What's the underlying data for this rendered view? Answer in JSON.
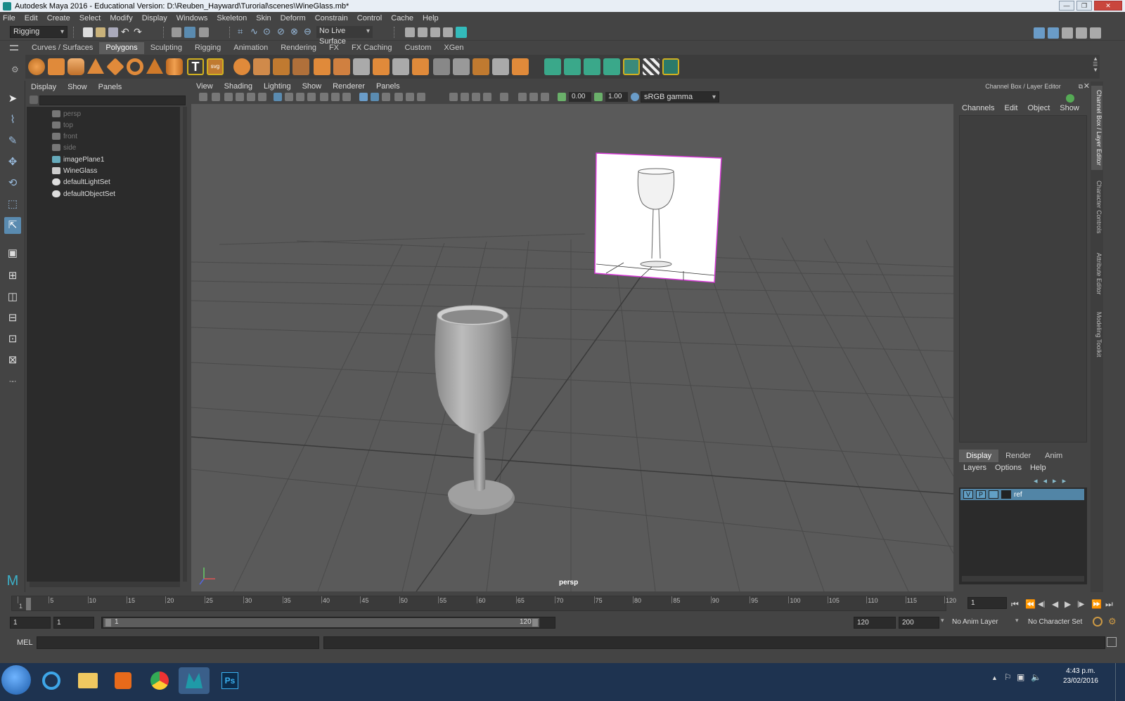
{
  "window": {
    "title": "Autodesk Maya 2016 - Educational Version: D:\\Reuben_Hayward\\Turorial\\scenes\\WineGlass.mb*",
    "min_label": "—",
    "max_label": "❐",
    "close_label": "✕"
  },
  "menubar": [
    "File",
    "Edit",
    "Create",
    "Select",
    "Modify",
    "Display",
    "Windows",
    "Skeleton",
    "Skin",
    "Deform",
    "Constrain",
    "Control",
    "Cache",
    "Help"
  ],
  "statusline": {
    "menuset": "Rigging",
    "live_surface": "No Live Surface"
  },
  "shelf": {
    "tabs": [
      "Curves / Surfaces",
      "Polygons",
      "Sculpting",
      "Rigging",
      "Animation",
      "Rendering",
      "FX",
      "FX Caching",
      "Custom",
      "XGen"
    ],
    "active_tab": "Polygons",
    "text_tool_label": "T",
    "svg_tool_label": "svg"
  },
  "outliner": {
    "menu": [
      "Display",
      "Show",
      "Panels"
    ],
    "items": [
      {
        "label": "persp",
        "dim": true,
        "icon": "camera-icon"
      },
      {
        "label": "top",
        "dim": true,
        "icon": "camera-icon"
      },
      {
        "label": "front",
        "dim": true,
        "icon": "camera-icon"
      },
      {
        "label": "side",
        "dim": true,
        "icon": "camera-icon"
      },
      {
        "label": "imagePlane1",
        "dim": false,
        "icon": "image-plane-icon"
      },
      {
        "label": "WineGlass",
        "dim": false,
        "icon": "mesh-icon"
      },
      {
        "label": "defaultLightSet",
        "dim": false,
        "icon": "set-icon"
      },
      {
        "label": "defaultObjectSet",
        "dim": false,
        "icon": "set-icon"
      }
    ]
  },
  "viewport": {
    "menu": [
      "View",
      "Shading",
      "Lighting",
      "Show",
      "Renderer",
      "Panels"
    ],
    "exposure": "0.00",
    "gamma": "1.00",
    "color_space": "sRGB gamma",
    "camera_label": "persp"
  },
  "channelbox": {
    "title": "Channel Box / Layer Editor",
    "menu": [
      "Channels",
      "Edit",
      "Object",
      "Show"
    ],
    "layer_tabs": [
      "Display",
      "Render",
      "Anim"
    ],
    "active_layer_tab": "Display",
    "layer_menu": [
      "Layers",
      "Options",
      "Help"
    ],
    "layers": [
      {
        "name": "ref",
        "v": "V",
        "p": "P"
      }
    ]
  },
  "sidetabs": [
    "Channel Box / Layer Editor",
    "Character Controls",
    "Attribute Editor",
    "Modeling Toolkit"
  ],
  "timeline": {
    "ticks": [
      "1",
      "5",
      "10",
      "15",
      "20",
      "25",
      "30",
      "35",
      "40",
      "45",
      "50",
      "55",
      "60",
      "65",
      "70",
      "75",
      "80",
      "85",
      "90",
      "95",
      "100",
      "105",
      "110",
      "115",
      "120"
    ],
    "current_frame": "1",
    "playback_buttons": [
      "⏮",
      "⏪",
      "◀|",
      "◀",
      "▶",
      "|▶",
      "⏩",
      "⏭"
    ]
  },
  "range": {
    "start": "1",
    "playback_start": "1",
    "slider_start": "1",
    "slider_end": "120",
    "playback_end": "120",
    "end": "200",
    "anim_layer": "No Anim Layer",
    "character_set": "No Character Set"
  },
  "cmdline": {
    "label": "MEL"
  },
  "taskbar": {
    "time": "4:43 p.m.",
    "date": "23/02/2016",
    "ps_label": "Ps"
  },
  "colors": {
    "accent": "#5285a6",
    "maya_bg": "#444444",
    "viewport_bg": "#5a5a5a",
    "image_plane_border": "#d63ad6"
  }
}
